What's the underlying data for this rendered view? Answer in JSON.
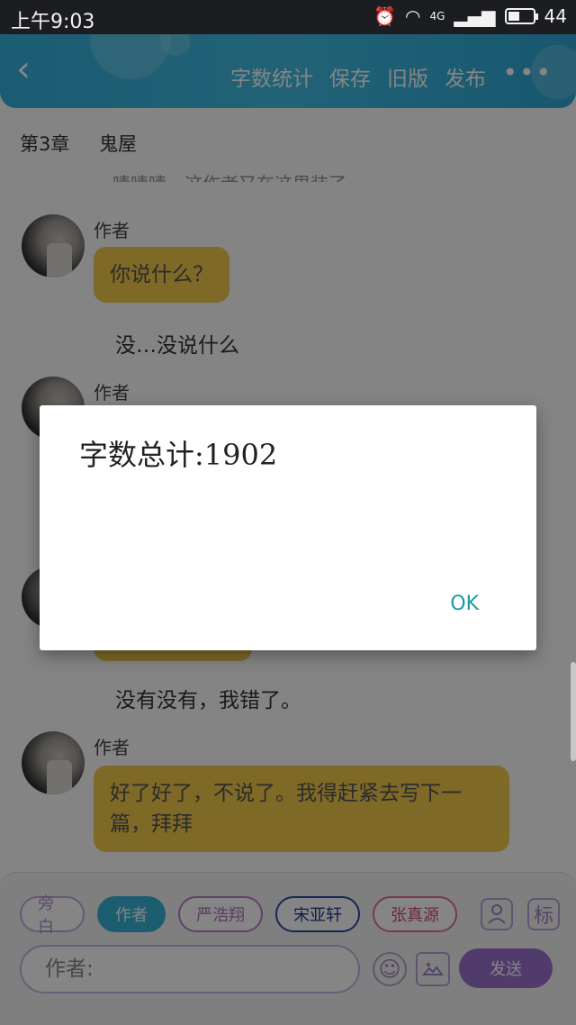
{
  "status_bar": {
    "time": "上午9:03",
    "network": "4G",
    "battery": "44",
    "battery_level": 0.44
  },
  "toolbar": {
    "back_icon": "chevron-left-icon",
    "actions": [
      "字数统计",
      "保存",
      "旧版",
      "发布"
    ],
    "more": "•••"
  },
  "chapter": {
    "number": "第3章",
    "title": "鬼屋"
  },
  "cutoff_text": "啧啧啧，这作者又在这里装了",
  "messages": [
    {
      "speaker": "作者",
      "text": "你说什么？"
    },
    {
      "speaker": "作者",
      "text": ""
    },
    {
      "speaker": "作者",
      "text": "好了好了，不说了。我得赶紧去写下一篇，拜拜"
    }
  ],
  "narrations": [
    "没…没说什么",
    "没有没有，我错了。"
  ],
  "roles": [
    "旁白",
    "作者",
    "严浩翔",
    "宋亚轩",
    "张真源"
  ],
  "tools": {
    "person_icon": "person-icon",
    "tag_label": "标"
  },
  "input": {
    "placeholder": "作者:",
    "emoji_icon": "smile-icon",
    "image_icon": "image-icon"
  },
  "send_label": "发送",
  "dialog": {
    "message": "字数总计:1902",
    "ok_label": "OK"
  },
  "colors": {
    "accent": "#3bb6df",
    "bubble": "#f2c94c",
    "send": "#9b72cf",
    "ok": "#1a9ba3"
  }
}
